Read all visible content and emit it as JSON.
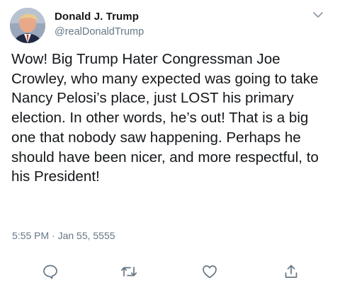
{
  "tweet": {
    "author_name": "Donald J. Trump",
    "author_handle": "@realDonaldTrump",
    "text": "Wow! Big Trump Hater Congressman Joe Crowley, who many expected was going to take Nancy Pelosi’s place, just LOST his primary election. In other words, he’s out! That is a big one that nobody saw happening. Perhaps he should have been nicer, and more respectful, to his President!",
    "timestamp": "5:55 PM · Jan 55, 5555"
  },
  "icons": {
    "menu": "chevron-down-icon",
    "reply": "reply-icon",
    "retweet": "retweet-icon",
    "like": "heart-icon",
    "share": "share-icon"
  },
  "colors": {
    "text": "#14171a",
    "secondary": "#657786",
    "icon": "#657786"
  }
}
